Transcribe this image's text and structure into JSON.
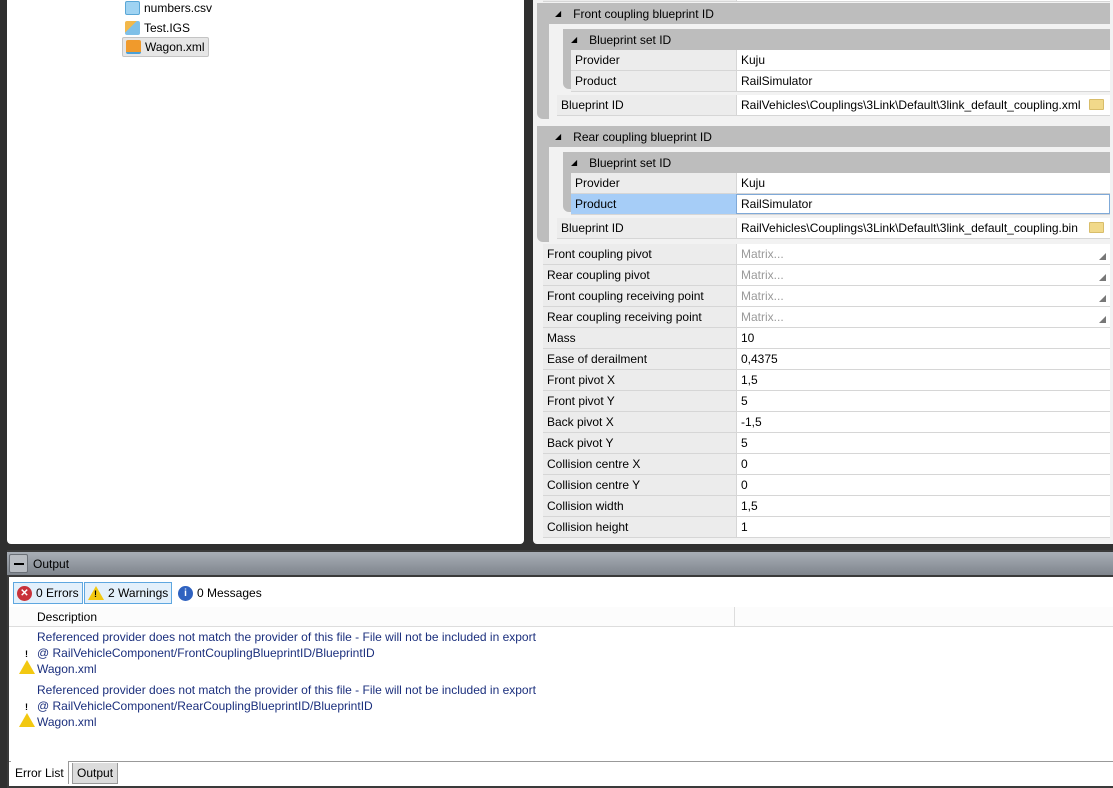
{
  "tree": {
    "items": [
      {
        "label": "numbers.csv",
        "icon": "csv-file-icon"
      },
      {
        "label": "Test.IGS",
        "icon": "igs-file-icon"
      },
      {
        "label": "Wagon.xml",
        "icon": "xml-blueprint-icon",
        "selected": true
      }
    ]
  },
  "props": {
    "front_group": "Front coupling blueprint ID",
    "rear_group": "Rear coupling blueprint ID",
    "set_group": "Blueprint set ID",
    "front": {
      "provider_label": "Provider",
      "provider": "Kuju",
      "product_label": "Product",
      "product": "RailSimulator",
      "bp_label": "Blueprint ID",
      "bp": "RailVehicles\\Couplings\\3Link\\Default\\3link_default_coupling.xml"
    },
    "rear": {
      "provider_label": "Provider",
      "provider": "Kuju",
      "product_label": "Product",
      "product": "RailSimulator",
      "bp_label": "Blueprint ID",
      "bp": "RailVehicles\\Couplings\\3Link\\Default\\3link_default_coupling.bin"
    },
    "rows": [
      {
        "name": "Front coupling pivot",
        "value": "Matrix...",
        "muted": true
      },
      {
        "name": "Rear coupling pivot",
        "value": "Matrix...",
        "muted": true
      },
      {
        "name": "Front coupling receiving point",
        "value": "Matrix...",
        "muted": true
      },
      {
        "name": "Rear coupling receiving point",
        "value": "Matrix...",
        "muted": true
      },
      {
        "name": "Mass",
        "value": "10"
      },
      {
        "name": "Ease of derailment",
        "value": "0,4375"
      },
      {
        "name": "Front pivot X",
        "value": "1,5"
      },
      {
        "name": "Front pivot Y",
        "value": "5"
      },
      {
        "name": "Back pivot X",
        "value": "-1,5"
      },
      {
        "name": "Back pivot Y",
        "value": "5"
      },
      {
        "name": "Collision centre X",
        "value": "0"
      },
      {
        "name": "Collision centre Y",
        "value": "0"
      },
      {
        "name": "Collision width",
        "value": "1,5"
      },
      {
        "name": "Collision height",
        "value": "1"
      }
    ]
  },
  "output": {
    "title": "Output",
    "errors": "0 Errors",
    "warnings": "2 Warnings",
    "messages": "0 Messages",
    "col_description": "Description",
    "items": [
      {
        "line1": "Referenced provider does not match the provider of this file - File will not be included in export",
        "line2": "@ RailVehicleComponent/FrontCouplingBlueprintID/BlueprintID",
        "line3": "Wagon.xml"
      },
      {
        "line1": "Referenced provider does not match the provider of this file - File will not be included in export",
        "line2": "@ RailVehicleComponent/RearCouplingBlueprintID/BlueprintID",
        "line3": "Wagon.xml"
      }
    ],
    "tabs": [
      "Error List",
      "Output"
    ]
  }
}
